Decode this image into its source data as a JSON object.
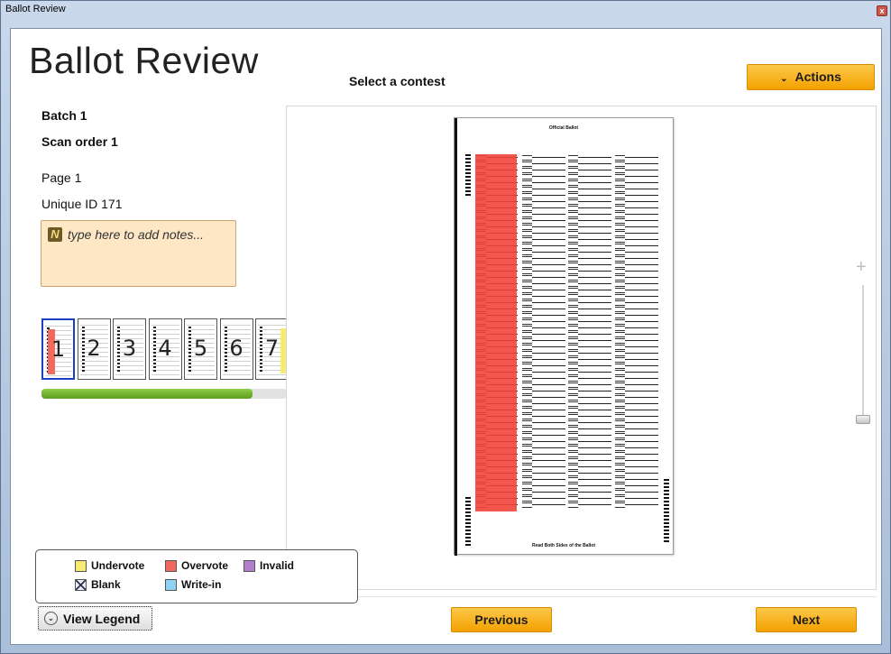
{
  "window": {
    "title": "Ballot Review",
    "close_glyph": "x"
  },
  "header": {
    "app_title": "Ballot Review",
    "contest_label": "Select a contest",
    "actions_label": "Actions",
    "actions_chevron": "⌄"
  },
  "info": {
    "batch": "Batch  1",
    "scan_order": "Scan order  1",
    "page": "Page  1",
    "unique_id": "Unique ID 171"
  },
  "notes": {
    "icon_letter": "N",
    "placeholder": "type here to add notes..."
  },
  "thumbnails": {
    "items": [
      "1",
      "2",
      "3",
      "4",
      "5",
      "6",
      "7"
    ],
    "selected_index": 0,
    "progress_fraction": 0.86
  },
  "ballot": {
    "header_text": "Official Ballot",
    "footer_text": "Read Both Sides of the Ballot"
  },
  "legend": {
    "items": [
      {
        "label": "Undervote",
        "color": "#f7ec6f"
      },
      {
        "label": "Overvote",
        "color": "#f26a5f"
      },
      {
        "label": "Invalid",
        "color": "#b27fcf"
      },
      {
        "label": "Blank",
        "color": "#e8ecff"
      },
      {
        "label": "Write-in",
        "color": "#8fd3f4"
      }
    ]
  },
  "footer": {
    "view_legend_label": "View Legend",
    "previous_label": "Previous",
    "next_label": "Next"
  },
  "colors": {
    "accent": "#f3a100",
    "overvote": "#f2443a",
    "progress": "#5d9e20",
    "selected_border": "#1d3fc4"
  }
}
